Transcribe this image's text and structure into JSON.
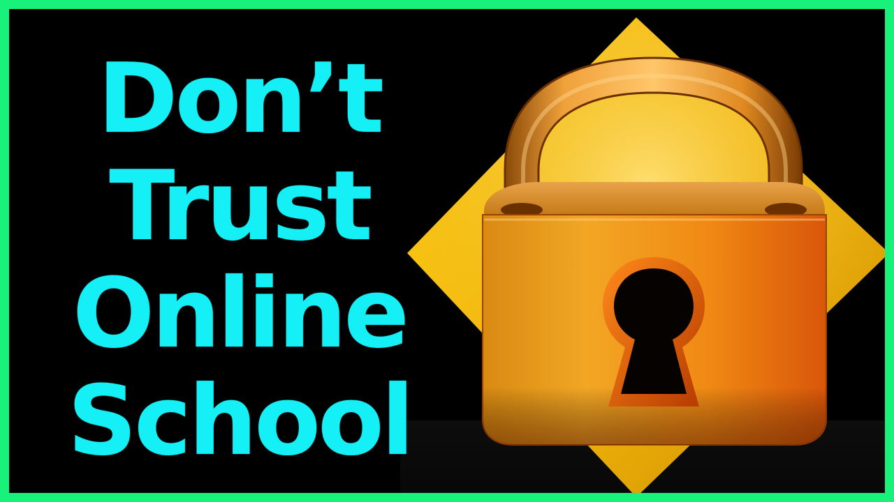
{
  "headline": {
    "lines": [
      "Don’t",
      "Trust",
      "Online",
      "School"
    ]
  },
  "colors": {
    "frame": "#19f27a",
    "background": "#000000",
    "headline_text": "#14f0f6",
    "lock_gold": "#f2a11b",
    "diamond_gold": "#f5c30d"
  },
  "icons": {
    "main": "padlock-icon",
    "keyhole": "keyhole-icon"
  }
}
